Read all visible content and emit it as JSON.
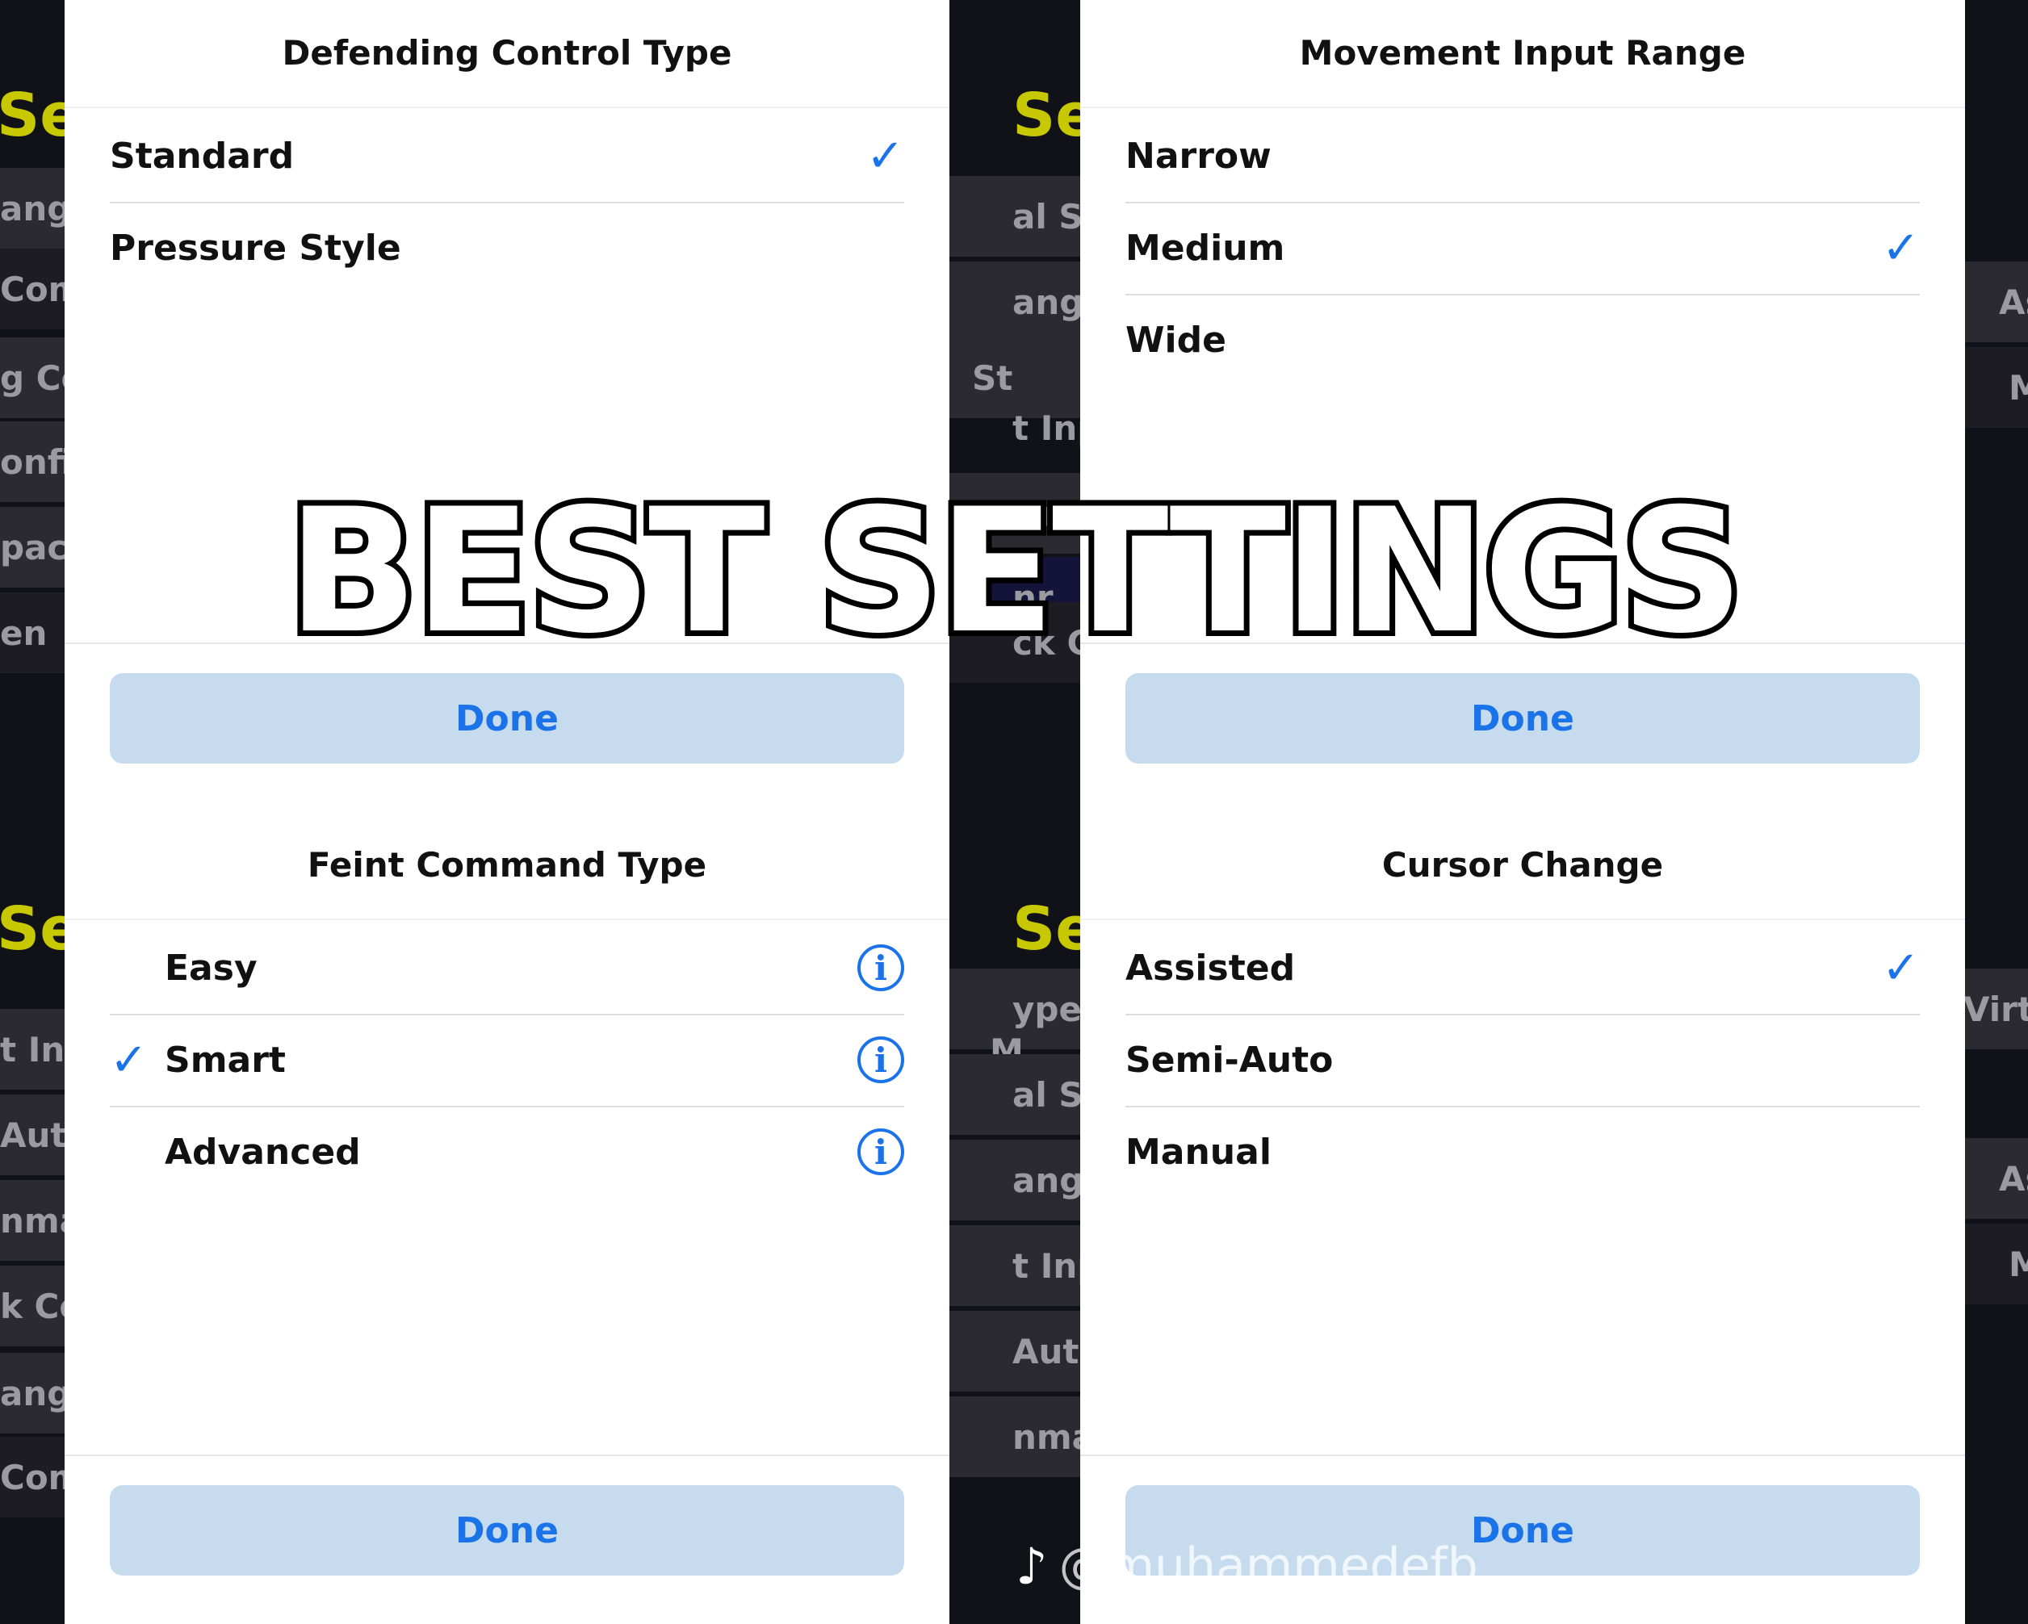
{
  "overlay": {
    "title": "BEST SETTINGS",
    "watermark_handle": "@muhammedefb",
    "watermark_icon": "tiktok-icon"
  },
  "background_fragments": {
    "left": [
      "Set",
      "ang",
      "Com",
      "g Co",
      "onfig",
      "pacit",
      "en",
      "Set",
      "t Inp",
      "Auto",
      "nmar",
      "k Co",
      "ang",
      "Com"
    ],
    "middle": [
      "Set",
      "al St",
      "ang",
      "St",
      "t Inp",
      "Auto",
      "nr",
      "ck Co",
      "Set",
      "ype",
      "M",
      "al St",
      "ang",
      "t Inp",
      "Auto",
      "nmar"
    ],
    "right": [
      "As",
      "M",
      "Virtu",
      "As",
      "M"
    ]
  },
  "panels": [
    {
      "title": "Defending Control Type",
      "options": [
        {
          "label": "Standard",
          "selected": true
        },
        {
          "label": "Pressure Style",
          "selected": false
        }
      ],
      "done_label": "Done"
    },
    {
      "title": "Movement Input Range",
      "options": [
        {
          "label": "Narrow",
          "selected": false
        },
        {
          "label": "Medium",
          "selected": true
        },
        {
          "label": "Wide",
          "selected": false
        }
      ],
      "done_label": "Done"
    },
    {
      "title": "Feint Command Type",
      "options": [
        {
          "label": "Easy",
          "selected": false
        },
        {
          "label": "Smart",
          "selected": true
        },
        {
          "label": "Advanced",
          "selected": false
        }
      ],
      "done_label": "Done"
    },
    {
      "title": "Cursor Change",
      "options": [
        {
          "label": "Assisted",
          "selected": true
        },
        {
          "label": "Semi-Auto",
          "selected": false
        },
        {
          "label": "Manual",
          "selected": false
        }
      ],
      "done_label": "Done"
    }
  ],
  "colors": {
    "accent": "#1a73e8",
    "done_button_bg": "#c6dcee",
    "background_yellow": "#c8c800"
  }
}
